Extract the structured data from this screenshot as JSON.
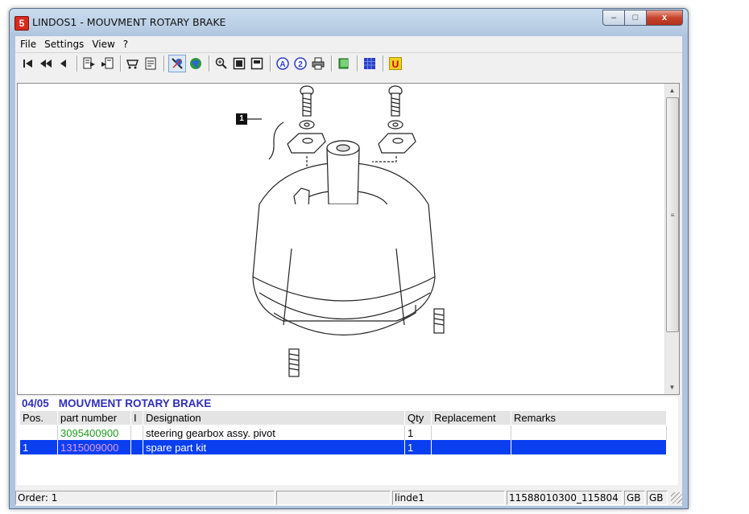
{
  "window": {
    "title": "LINDOS1 - MOUVMENT ROTARY BRAKE",
    "app_icon_glyph": "5"
  },
  "window_buttons": {
    "minimize": "–",
    "maximize": "□",
    "close": "x"
  },
  "menu": [
    "File",
    "Settings",
    "View",
    "?"
  ],
  "toolbar_icons": [
    "first-page-icon",
    "prev-fast-icon",
    "prev-icon",
    "sep",
    "export-icon",
    "import-icon",
    "sep",
    "cart-icon",
    "notepad-icon",
    "sep",
    "erase-icon",
    "globe-icon",
    "sep",
    "zoom-in-icon",
    "fit-page-icon",
    "page-width-icon",
    "sep",
    "annotation-a-icon",
    "annotation-2-icon",
    "print-icon",
    "sep",
    "book-icon",
    "sep",
    "grid-icon",
    "sep",
    "u-icon"
  ],
  "drawing": {
    "callout_number": "1"
  },
  "parts": {
    "page": "04/05",
    "title": "MOUVMENT ROTARY BRAKE",
    "columns": [
      "Pos.",
      "part number",
      "I",
      "Designation",
      "Qty",
      "Replacement",
      "Remarks"
    ],
    "rows": [
      {
        "pos": "",
        "part_number": "3095400900",
        "i": "",
        "designation": "steering gearbox assy. pivot",
        "qty": "1",
        "replacement": "",
        "remarks": ""
      },
      {
        "pos": "1",
        "part_number": "1315009000",
        "i": "",
        "designation": "spare part kit",
        "qty": "1",
        "replacement": "",
        "remarks": ""
      }
    ]
  },
  "status": {
    "order": "Order: 1",
    "blank": "",
    "user": "linde1",
    "doc": "11588010300_115804",
    "lang1": "GB",
    "lang2": "GB"
  },
  "colors": {
    "selection": "#0a3ff0",
    "title_text": "#2e2eb8",
    "part_green": "#1f9a1f"
  }
}
